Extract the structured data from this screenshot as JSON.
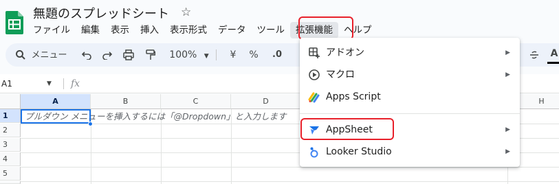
{
  "doc": {
    "title": "無題のスプレッドシート"
  },
  "menubar": {
    "items": [
      "ファイル",
      "編集",
      "表示",
      "挿入",
      "表示形式",
      "データ",
      "ツール",
      "拡張機能",
      "ヘルプ"
    ]
  },
  "toolbar": {
    "search_label": "メニュー",
    "zoom": "100%",
    "currency": "¥",
    "percent": "%",
    "decimal_decrease": ".0",
    "font_color_label": "A"
  },
  "formula_bar": {
    "cell_ref": "A1",
    "fx": "fx"
  },
  "grid": {
    "columns": [
      "A",
      "B",
      "C",
      "D",
      "H"
    ],
    "rows": [
      "1",
      "2",
      "3",
      "4",
      "5"
    ],
    "a1_hint": "プルダウン メニューを挿入するには「@Dropdown」と入力します"
  },
  "extensions_menu": {
    "items": [
      {
        "label": "アドオン",
        "icon": "addon-icon",
        "submenu": true
      },
      {
        "label": "マクロ",
        "icon": "macro-icon",
        "submenu": true
      },
      {
        "label": "Apps Script",
        "icon": "apps-script-icon",
        "submenu": false
      },
      {
        "label": "AppSheet",
        "icon": "appsheet-icon",
        "submenu": true
      },
      {
        "label": "Looker Studio",
        "icon": "looker-studio-icon",
        "submenu": true
      }
    ]
  },
  "colors": {
    "highlight": "#e8202a",
    "accent": "#1a73e8",
    "sheets_green": "#0f9d58"
  }
}
